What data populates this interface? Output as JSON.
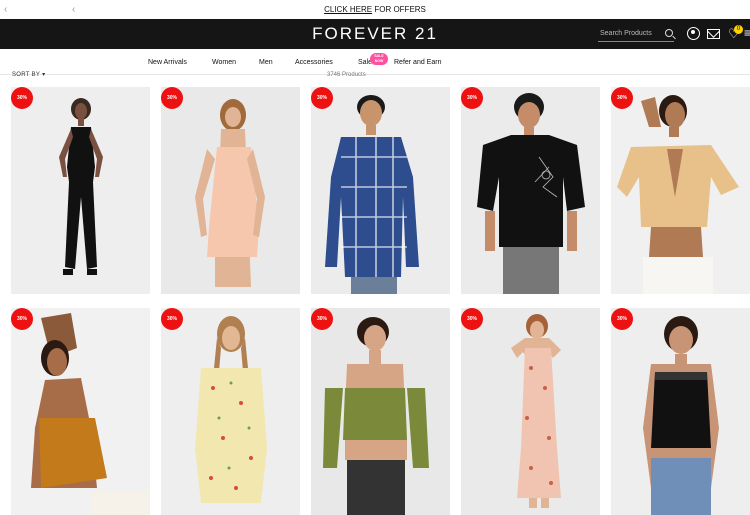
{
  "announcement": {
    "link": "CLICK HERE",
    "text": " FOR OFFERS"
  },
  "brand": "FOREVER 21",
  "search": {
    "placeholder": "Search Products"
  },
  "wishlist_count": "0",
  "nav": {
    "items": [
      "New Arrivals",
      "Women",
      "Men",
      "Accessories",
      "Sale",
      "Refer and Earn"
    ],
    "sale_tag": "SALE NOW"
  },
  "listing": {
    "sort_label": "SORT BY",
    "product_count": "3746 Products"
  },
  "colors": {
    "header_bg": "#151515",
    "discount_badge": "#ee1111",
    "sale_tag": "#ff4fa0",
    "wishlist_badge": "#ffd400"
  },
  "products": [
    {
      "discount": "30%",
      "icon": "black-cutout-jumpsuit",
      "bg": "#eeeeee"
    },
    {
      "discount": "30%",
      "icon": "peach-romper",
      "bg": "#e9e9e9"
    },
    {
      "discount": "30%",
      "icon": "blue-plaid-shirt",
      "bg": "#ececec"
    },
    {
      "discount": "30%",
      "icon": "black-graphic-tee",
      "bg": "#ebebeb"
    },
    {
      "discount": "30%",
      "icon": "tan-satin-tie-top",
      "bg": "#f0f0f0"
    },
    {
      "discount": "30%",
      "icon": "mustard-halter-top",
      "bg": "#f1f1f1"
    },
    {
      "discount": "30%",
      "icon": "floral-halter-romper",
      "bg": "#eeeeee"
    },
    {
      "discount": "30%",
      "icon": "green-tube-top",
      "bg": "#e8e8e8"
    },
    {
      "discount": "30%",
      "icon": "floral-maxi-dress",
      "bg": "#eaeaea"
    },
    {
      "discount": "30%",
      "icon": "black-lace-tank",
      "bg": "#eeeeee"
    }
  ]
}
